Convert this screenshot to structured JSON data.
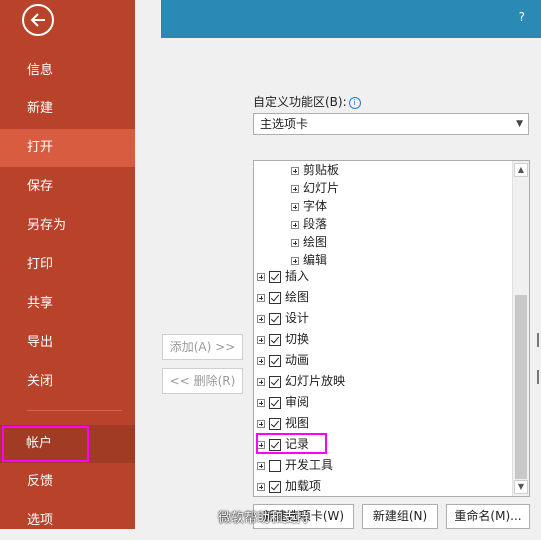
{
  "sidebar": {
    "items": [
      {
        "label": "信息"
      },
      {
        "label": "新建"
      },
      {
        "label": "打开"
      },
      {
        "label": "保存"
      },
      {
        "label": "另存为"
      },
      {
        "label": "打印"
      },
      {
        "label": "共享"
      },
      {
        "label": "导出"
      },
      {
        "label": "关闭"
      },
      {
        "label": "帐户"
      },
      {
        "label": "反馈"
      },
      {
        "label": "选项"
      }
    ]
  },
  "dialog": {
    "help": "?",
    "customize_label": "自定义功能区(B):",
    "customize_select": "主选项卡",
    "tree": [
      {
        "label": "剪贴板",
        "checked": null
      },
      {
        "label": "幻灯片",
        "checked": null
      },
      {
        "label": "字体",
        "checked": null
      },
      {
        "label": "段落",
        "checked": null
      },
      {
        "label": "绘图",
        "checked": null
      },
      {
        "label": "编辑",
        "checked": null
      },
      {
        "label": "插入",
        "checked": true
      },
      {
        "label": "绘图",
        "checked": true
      },
      {
        "label": "设计",
        "checked": true
      },
      {
        "label": "切换",
        "checked": true
      },
      {
        "label": "动画",
        "checked": true
      },
      {
        "label": "幻灯片放映",
        "checked": true
      },
      {
        "label": "审阅",
        "checked": true
      },
      {
        "label": "视图",
        "checked": true
      },
      {
        "label": "记录",
        "checked": true
      },
      {
        "label": "开发工具",
        "checked": false
      },
      {
        "label": "加载项",
        "checked": true
      }
    ],
    "add_button": "添加(A) >>",
    "remove_button": "<< 删除(R)",
    "new_tab_button": "新建选项卡(W)",
    "new_group_button": "新建组(N)",
    "rename_button": "重命名(M)..."
  },
  "watermark": "微软帮助和支持"
}
